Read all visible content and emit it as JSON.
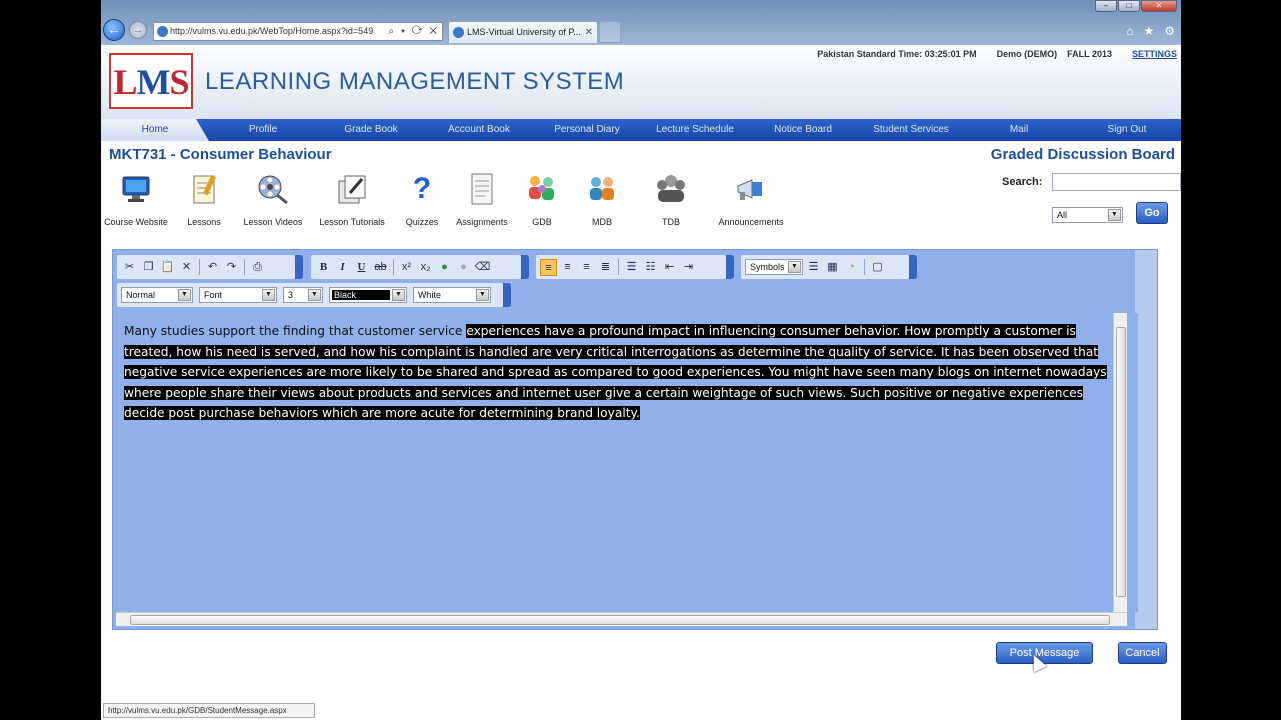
{
  "browser": {
    "address_url": "http://vulms.vu.edu.pk/WebTop/Home.aspx?id=549",
    "address_actions": "⌕ ▾ ⟳ ✕",
    "tab_title": "LMS-Virtual University of P...",
    "status_url": "http://vulms.vu.edu.pk/GDB/StudentMessage.aspx"
  },
  "header": {
    "logo_l": "L",
    "logo_m": "M",
    "logo_s": "S",
    "title": "LEARNING MANAGEMENT SYSTEM",
    "time": "Pakistan Standard Time: 03:25:01 PM",
    "user": "Demo (DEMO)",
    "semester": "FALL 2013",
    "settings": "SETTINGS"
  },
  "menu": [
    "Home",
    "Profile",
    "Grade Book",
    "Account Book",
    "Personal Diary",
    "Lecture Schedule",
    "Notice Board",
    "Student Services",
    "Mail",
    "Sign Out"
  ],
  "course_title": "MKT731 - Consumer Behaviour",
  "page_heading": "Graded Discussion Board",
  "search": {
    "label": "Search:",
    "filter_value": "All",
    "go_label": "Go"
  },
  "nav_icons": [
    {
      "label": "Course Website",
      "icon": "monitor-icon"
    },
    {
      "label": "Lessons",
      "icon": "notepad-icon"
    },
    {
      "label": "Lesson Videos",
      "icon": "film-reel-icon"
    },
    {
      "label": "Lesson Tutorials",
      "icon": "tutorial-icon"
    },
    {
      "label": "Quizzes",
      "icon": "question-icon"
    },
    {
      "label": "Assignments",
      "icon": "assignment-icon"
    },
    {
      "label": "GDB",
      "icon": "gdb-people-icon"
    },
    {
      "label": "MDB",
      "icon": "mdb-people-icon"
    },
    {
      "label": "TDB",
      "icon": "tdb-people-icon"
    },
    {
      "label": "Announcements",
      "icon": "megaphone-icon"
    }
  ],
  "editor": {
    "format": "Normal",
    "font": "Font",
    "size": "3",
    "fore_color": "Black",
    "back_color": "White",
    "symbols": "Symbols",
    "text_plain": "Many studies support the finding that customer service ",
    "text_selected": "experiences have a profound impact in influencing consumer behavior. How promptly a customer is treated, how his need is served, and how his complaint is handled are very critical interrogations as determine the quality of service. It has been observed that negative service experiences are more likely to be shared and spread as compared to good experiences. You might have seen many blogs on internet nowadays where people share their views about products and services and internet user give a certain weightage of such views. Such positive or negative experiences decide post purchase behaviors which are more acute for determining brand loyalty."
  },
  "buttons": {
    "post": "Post Message",
    "cancel": "Cancel"
  }
}
